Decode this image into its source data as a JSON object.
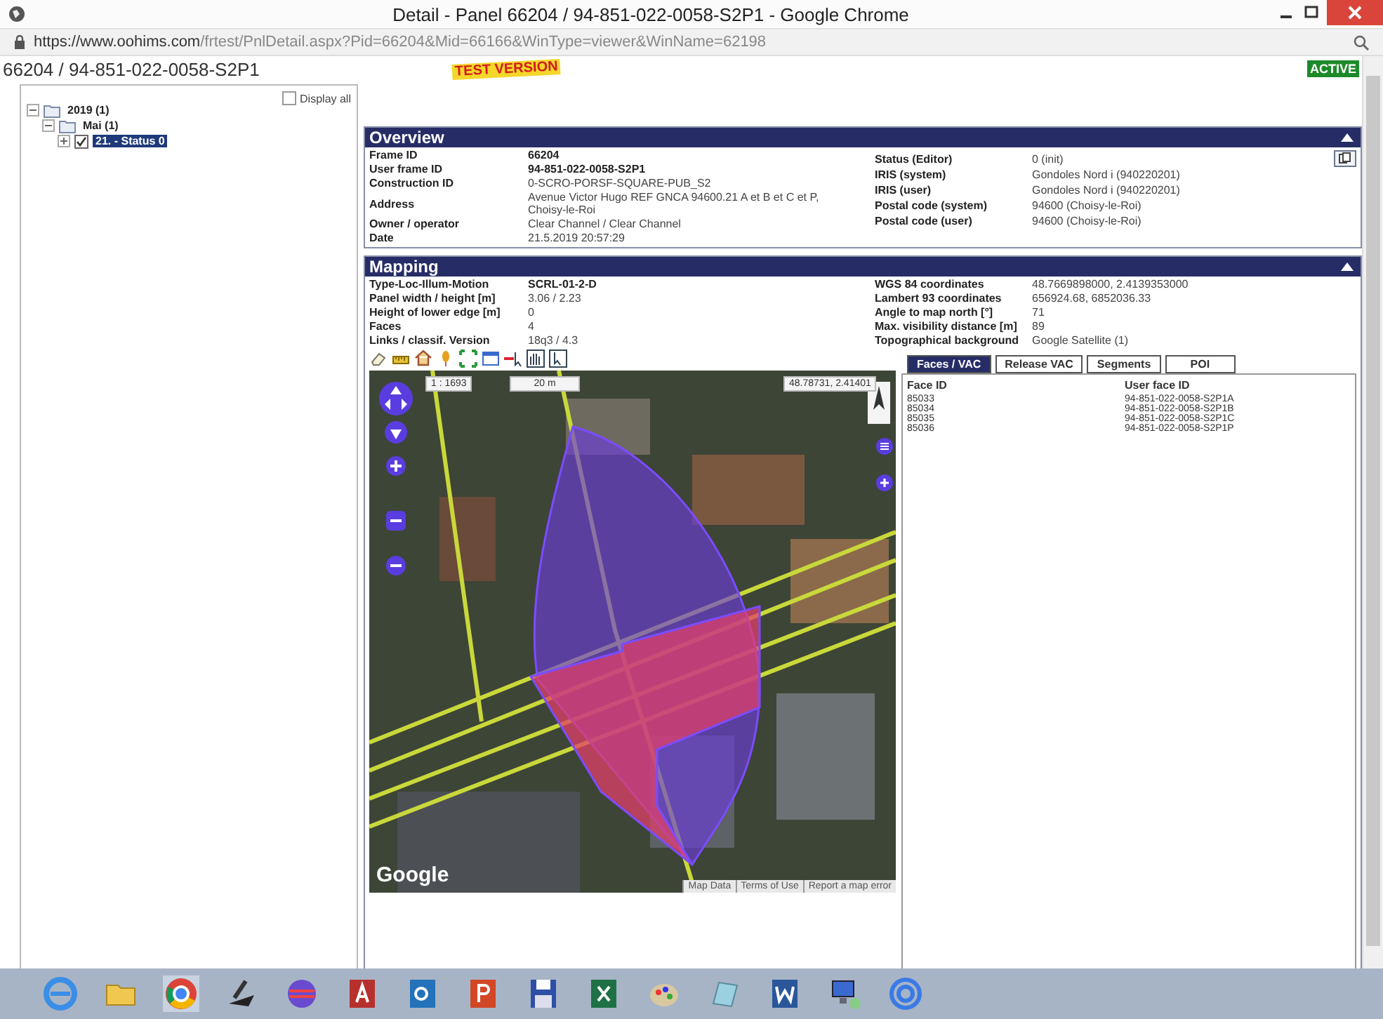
{
  "window": {
    "title": "Detail - Panel 66204 / 94-851-022-0058-S2P1 - Google Chrome"
  },
  "address_bar": {
    "url_host": "https://www.oohims.com",
    "url_path": "/frtest/PnlDetail.aspx?Pid=66204&Mid=66166&WinType=viewer&WinName=62198"
  },
  "header": {
    "title": "66204 / 94-851-022-0058-S2P1",
    "test_label": "TEST VERSION",
    "status_badge": "ACTIVE"
  },
  "sidebar": {
    "display_all": {
      "label": "Display all",
      "checked": false
    },
    "tree": [
      {
        "label": "2019 (1)",
        "expanded": true,
        "children": [
          {
            "label": "Mai (1)",
            "expanded": true,
            "children": [
              {
                "label": "21. - Status 0",
                "expanded": false,
                "checked": true,
                "selected": true
              }
            ]
          }
        ]
      }
    ]
  },
  "overview": {
    "title": "Overview",
    "left_fields": [
      {
        "label": "Frame ID",
        "value": "66204",
        "bold": true
      },
      {
        "label": "User frame ID",
        "value": "94-851-022-0058-S2P1",
        "bold": true
      },
      {
        "label": "Construction ID",
        "value": "0-SCRO-PORSF-SQUARE-PUB_S2",
        "bold": false
      },
      {
        "label": "Address",
        "value": "Avenue Victor Hugo REF GNCA 94600.21 A et B et C et P, Choisy-le-Roi",
        "bold": false
      },
      {
        "label": "Owner / operator",
        "value": "Clear Channel / Clear Channel",
        "bold": false
      },
      {
        "label": "Date",
        "value": "21.5.2019 20:57:29",
        "bold": false
      }
    ],
    "right_fields": [
      {
        "label": "Status (Editor)",
        "value": "0   (init)"
      },
      {
        "label": "IRIS (system)",
        "value": "Gondoles Nord i (940220201)"
      },
      {
        "label": "IRIS (user)",
        "value": "Gondoles Nord i (940220201)"
      },
      {
        "label": "Postal code (system)",
        "value": "94600 (Choisy-le-Roi)"
      },
      {
        "label": "Postal code (user)",
        "value": "94600 (Choisy-le-Roi)"
      }
    ]
  },
  "mapping": {
    "title": "Mapping",
    "left_fields": [
      {
        "label": "Type-Loc-Illum-Motion",
        "value": "SCRL-01-2-D",
        "bold": true
      },
      {
        "label": "Panel width / height [m]",
        "value": "3.06 / 2.23",
        "bold": false
      },
      {
        "label": "Height of lower edge [m]",
        "value": "0",
        "bold": false
      },
      {
        "label": "Faces",
        "value": "4",
        "bold": false
      },
      {
        "label": "Links / classif. Version",
        "value": "18q3 / 4.3",
        "bold": false
      }
    ],
    "right_fields": [
      {
        "label": "WGS 84 coordinates",
        "value": "48.7669898000, 2.4139353000"
      },
      {
        "label": "Lambert 93 coordinates",
        "value": "656924.68, 6852036.33"
      },
      {
        "label": "Angle to map north [°]",
        "value": "71"
      },
      {
        "label": "Max. visibility distance [m]",
        "value": "89"
      },
      {
        "label": "Topographical background",
        "value": "Google Satellite (1)"
      }
    ],
    "map": {
      "scale": "1 : 1693",
      "scale_bar": "20 m",
      "coordinates": "48.78731, 2.41401",
      "logo": "Google",
      "footer_links": [
        "Map Data",
        "Terms of Use",
        "Report a map error"
      ]
    },
    "tabs": [
      {
        "label": "Faces / VAC",
        "selected": true
      },
      {
        "label": "Release VAC",
        "selected": false
      },
      {
        "label": "Segments",
        "selected": false
      },
      {
        "label": "POI",
        "selected": false
      }
    ],
    "faces_table": {
      "columns": [
        "Face ID",
        "User face ID"
      ],
      "rows": [
        [
          "85033",
          "94-851-022-0058-S2P1A"
        ],
        [
          "85034",
          "94-851-022-0058-S2P1B"
        ],
        [
          "85035",
          "94-851-022-0058-S2P1C"
        ],
        [
          "85036",
          "94-851-022-0058-S2P1P"
        ]
      ]
    }
  }
}
